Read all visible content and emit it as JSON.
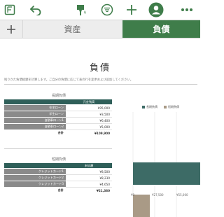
{
  "toolbar": {
    "icons": [
      "library-icon",
      "undo-icon",
      "paintbrush-icon",
      "format-icon",
      "add-icon",
      "collaborate-icon",
      "more-icon"
    ]
  },
  "tabs": {
    "add_label": "+",
    "items": [
      {
        "label": "資産",
        "active": false
      },
      {
        "label": "負債",
        "active": true
      }
    ]
  },
  "document": {
    "title": "負債",
    "intro": "残りかた負債総額を計算します。ご自分の負債に応じて表の行を変更および追加してください。",
    "long_term": {
      "title": "長期負債",
      "header_value": "元金残高",
      "rows": [
        {
          "name": "住宅ローン",
          "value": "¥95,000"
        },
        {
          "name": "学生ローン",
          "value": "¥3,500"
        },
        {
          "name": "自動車ローン1",
          "value": "¥6,400"
        },
        {
          "name": "自動車ローン2",
          "value": "¥5,000"
        }
      ],
      "total_label": "合計",
      "total_value": "¥109,900"
    },
    "short_term": {
      "title": "短期負債",
      "header_value": "未払額",
      "rows": [
        {
          "name": "クレジットカード1",
          "value": "¥8,500"
        },
        {
          "name": "クレジットカード2",
          "value": "¥8,230"
        },
        {
          "name": "クレジットカード3",
          "value": "¥4,650"
        }
      ],
      "total_label": "合計",
      "total_value": "¥21,380"
    }
  },
  "chart_data": {
    "type": "bar",
    "orientation": "horizontal",
    "categories": [
      "長期負債",
      "短期負債"
    ],
    "series": [
      {
        "name": "長期負債",
        "values": [
          109900
        ]
      },
      {
        "name": "短期負債",
        "values": [
          21380
        ]
      }
    ],
    "x_ticks": [
      "¥0",
      "¥27,500",
      "¥55,000"
    ],
    "colors": {
      "long_term": "#3d6b66",
      "short_term": "#a99a86"
    },
    "legend_position": "top"
  },
  "colors": {
    "accent_green": "#3f7d4a",
    "table_header": "#2f5f59",
    "table_name": "#8a8a8a"
  }
}
